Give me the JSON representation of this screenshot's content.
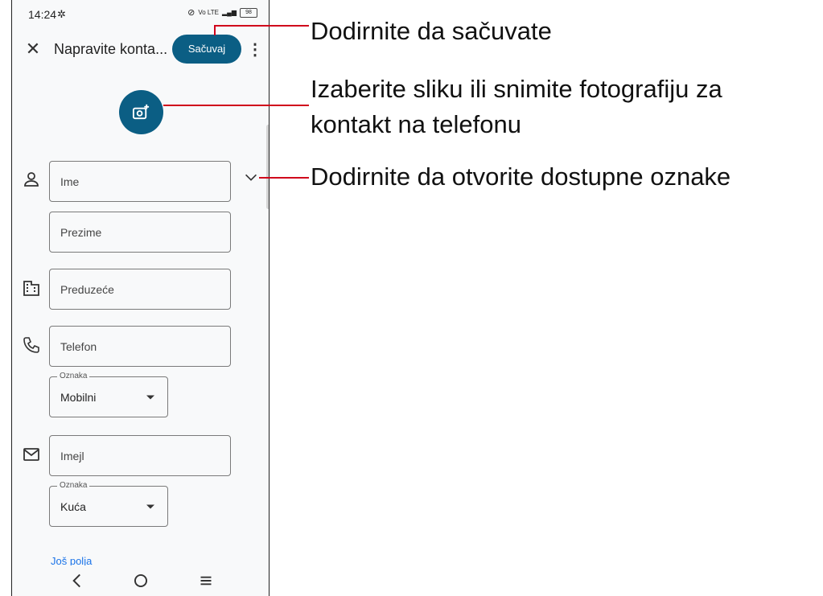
{
  "status_bar": {
    "time": "14:24",
    "battery": "98"
  },
  "app_bar": {
    "title": "Napravite konta...",
    "save_label": "Sačuvaj"
  },
  "form": {
    "first_name_placeholder": "Ime",
    "last_name_placeholder": "Prezime",
    "company_placeholder": "Preduzeće",
    "phone_placeholder": "Telefon",
    "phone_label_legend": "Oznaka",
    "phone_label_value": "Mobilni",
    "email_placeholder": "Imejl",
    "email_label_legend": "Oznaka",
    "email_label_value": "Kuća",
    "more_fields": "Još polja"
  },
  "annotations": {
    "save": "Dodirnite da sačuvate",
    "photo_line1": "Izaberite sliku ili snimite fotografiju za",
    "photo_line2": "kontakt na telefonu",
    "labels": "Dodirnite da otvorite dostupne oznake"
  },
  "colors": {
    "accent": "#0b5e84",
    "annotation_line": "#d0021b",
    "link": "#1a73e8"
  },
  "icons": {
    "gear": "gear-icon",
    "close": "close-icon",
    "more": "more-vert-icon",
    "add_photo": "add-photo-icon",
    "person": "person-icon",
    "company": "business-icon",
    "phone": "phone-icon",
    "email": "mail-icon",
    "expand": "chevron-down-icon"
  }
}
